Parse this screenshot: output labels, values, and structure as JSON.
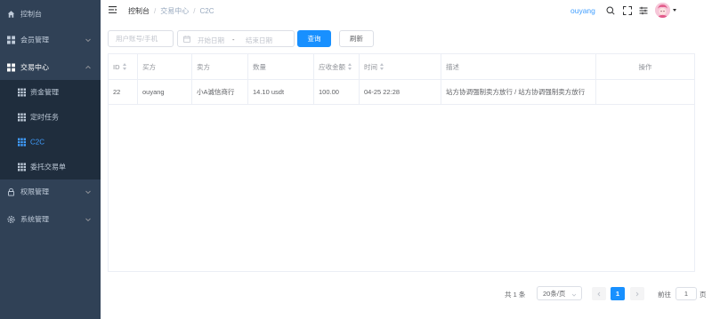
{
  "colors": {
    "sidebar_bg": "#304156",
    "sidebar_submenu_bg": "#1f2d3d",
    "sidebar_text": "#bfcbd9",
    "active_text": "#409eff",
    "primary": "#1890ff"
  },
  "sidebar": {
    "items": [
      {
        "label": "控制台",
        "icon": "dashboard-icon"
      },
      {
        "label": "会员管理",
        "icon": "grid-icon",
        "arrow": "chevron-down-icon"
      },
      {
        "label": "交易中心",
        "icon": "grid-icon",
        "arrow": "chevron-up-icon"
      },
      {
        "label": "资金管理",
        "icon": "table-icon"
      },
      {
        "label": "定时任务",
        "icon": "table-icon"
      },
      {
        "label": "C2C",
        "icon": "table-icon"
      },
      {
        "label": "委托交易单",
        "icon": "table-icon"
      },
      {
        "label": "权限管理",
        "icon": "lock-icon",
        "arrow": "chevron-down-icon"
      },
      {
        "label": "系统管理",
        "icon": "gear-icon",
        "arrow": "chevron-down-icon"
      }
    ]
  },
  "header": {
    "breadcrumb": [
      "控制台",
      "交易中心",
      "C2C"
    ],
    "username": "ouyang"
  },
  "filters": {
    "account_placeholder": "用户账号/手机",
    "start_placeholder": "开始日期",
    "range_separator": "-",
    "end_placeholder": "结束日期",
    "search_label": "查询",
    "refresh_label": "刷新"
  },
  "table": {
    "headers": [
      "ID",
      "买方",
      "卖方",
      "数量",
      "应收金额",
      "时间",
      "描述",
      "操作"
    ],
    "rows": [
      [
        "22",
        "ouyang",
        "小A诚信商行",
        "14.10 usdt",
        "100.00",
        "04-25 22:28",
        "站方协调强制卖方放行 / 站方协调强制卖方放行",
        ""
      ]
    ]
  },
  "pagination": {
    "total": "共 1 条",
    "page_size": "20条/页",
    "current_page": "1",
    "goto_prefix": "前往",
    "goto_value": "1",
    "goto_suffix": "页"
  }
}
